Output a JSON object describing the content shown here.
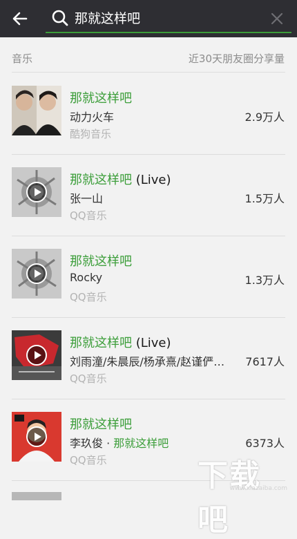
{
  "search": {
    "query": "那就这样吧"
  },
  "header": {
    "section": "音乐",
    "share_metric": "近30天朋友圈分享量"
  },
  "colors": {
    "accent": "#3c9e3a",
    "topbar": "#2e2e33"
  },
  "results": [
    {
      "title": "那就这样吧",
      "title_suffix": "",
      "artist": "动力火车",
      "artist_hl": "",
      "source": "酷狗音乐",
      "count": "2.9万人",
      "thumb": "duo-photo",
      "has_play": false
    },
    {
      "title": "那就这样吧",
      "title_suffix": " (Live)",
      "artist": "张一山",
      "artist_hl": "",
      "source": "QQ音乐",
      "count": "1.5万人",
      "thumb": "grey-art",
      "has_play": true
    },
    {
      "title": "那就这样吧",
      "title_suffix": "",
      "artist": "Rocky",
      "artist_hl": "",
      "source": "QQ音乐",
      "count": "1.3万人",
      "thumb": "grey-art",
      "has_play": true
    },
    {
      "title": "那就这样吧",
      "title_suffix": " (Live)",
      "artist": "刘雨潼/朱晨辰/杨承熹/赵谨俨…",
      "artist_hl": "",
      "source": "QQ音乐",
      "count": "7617人",
      "thumb": "red-show",
      "has_play": true
    },
    {
      "title": "那就这样吧",
      "title_suffix": "",
      "artist": "李玖俊 · ",
      "artist_hl": "那就这样吧",
      "source": "QQ音乐",
      "count": "6373人",
      "thumb": "red-portrait",
      "has_play": true
    }
  ],
  "watermark": {
    "big": "下载吧",
    "small": "www.xiazaiba.com"
  }
}
